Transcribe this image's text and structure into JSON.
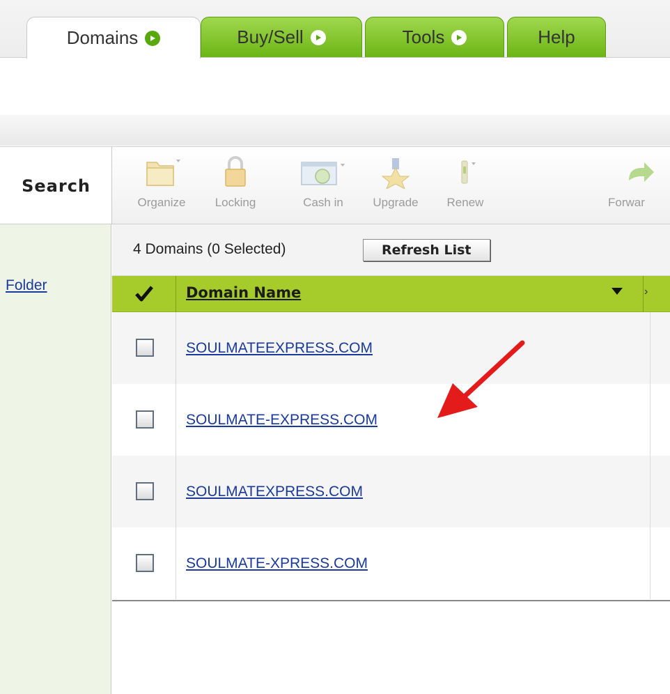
{
  "tabs": [
    {
      "label": "Domains",
      "active": true
    },
    {
      "label": "Buy/Sell",
      "active": false
    },
    {
      "label": "Tools",
      "active": false
    },
    {
      "label": "Help",
      "active": false
    }
  ],
  "left_panel": {
    "title": "Search",
    "folder_link": "Folder"
  },
  "toolbar": [
    {
      "label": "Organize",
      "icon": "folder-icon"
    },
    {
      "label": "Locking",
      "icon": "lock-icon"
    },
    {
      "label": "Cash in",
      "icon": "cash-in-icon"
    },
    {
      "label": "Upgrade",
      "icon": "upgrade-icon"
    },
    {
      "label": "Renew",
      "icon": "renew-icon"
    },
    {
      "label": "Forwar",
      "icon": "forward-icon"
    }
  ],
  "list": {
    "count_text": "4 Domains (0 Selected)",
    "refresh_label": "Refresh List",
    "column_header": "Domain Name",
    "rows": [
      {
        "name": "SOULMATEEXPRESS.COM",
        "checked": false
      },
      {
        "name": "SOULMATE-EXPRESS.COM",
        "checked": false
      },
      {
        "name": "SOULMATEXPRESS.COM",
        "checked": false
      },
      {
        "name": "SOULMATE-XPRESS.COM",
        "checked": false
      }
    ]
  },
  "colors": {
    "tab_green": "#7cc224",
    "header_green": "#a6cc2c",
    "link_blue": "#1a3a9a",
    "annotation_red": "#e31b1b"
  }
}
